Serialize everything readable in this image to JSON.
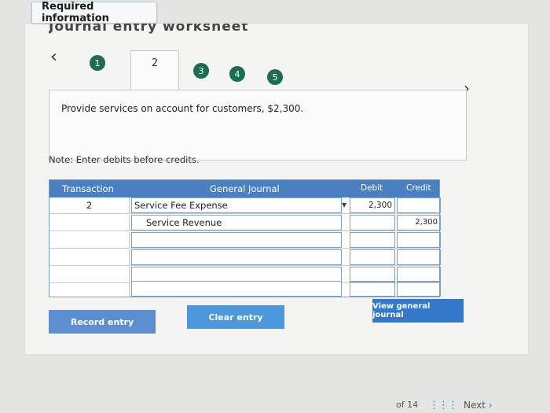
{
  "header": {
    "required_label": "Required information",
    "worksheet_title": "Journal entry worksheet"
  },
  "steps": {
    "items": [
      "1",
      "2",
      "3",
      "4",
      "5"
    ],
    "active": "2"
  },
  "description": "Provide services on account for customers, $2,300.",
  "note": "Note: Enter debits before credits.",
  "journal": {
    "headers": {
      "transaction": "Transaction",
      "general_journal": "General Journal",
      "debit": "Debit",
      "credit": "Credit"
    },
    "rows": [
      {
        "transaction": "2",
        "account": "Service Fee Expense",
        "debit": "2,300",
        "credit": ""
      },
      {
        "transaction": "",
        "account": "Service Revenue",
        "debit": "",
        "credit": "2,300"
      },
      {
        "transaction": "",
        "account": "",
        "debit": "",
        "credit": ""
      },
      {
        "transaction": "",
        "account": "",
        "debit": "",
        "credit": ""
      },
      {
        "transaction": "",
        "account": "",
        "debit": "",
        "credit": ""
      },
      {
        "transaction": "",
        "account": "",
        "debit": "",
        "credit": ""
      }
    ]
  },
  "buttons": {
    "record": "Record entry",
    "clear": "Clear entry",
    "view": "View general journal"
  },
  "footer": {
    "page_of": "of 14",
    "next": "Next"
  },
  "icons": {
    "prev": "chevron-left-icon",
    "next": "chevron-right-icon",
    "dropdown": "caret-down-icon"
  },
  "colors": {
    "step_green": "#1d6e4e",
    "header_blue": "#4a7fc1",
    "button_blue": "#4d97dd"
  }
}
